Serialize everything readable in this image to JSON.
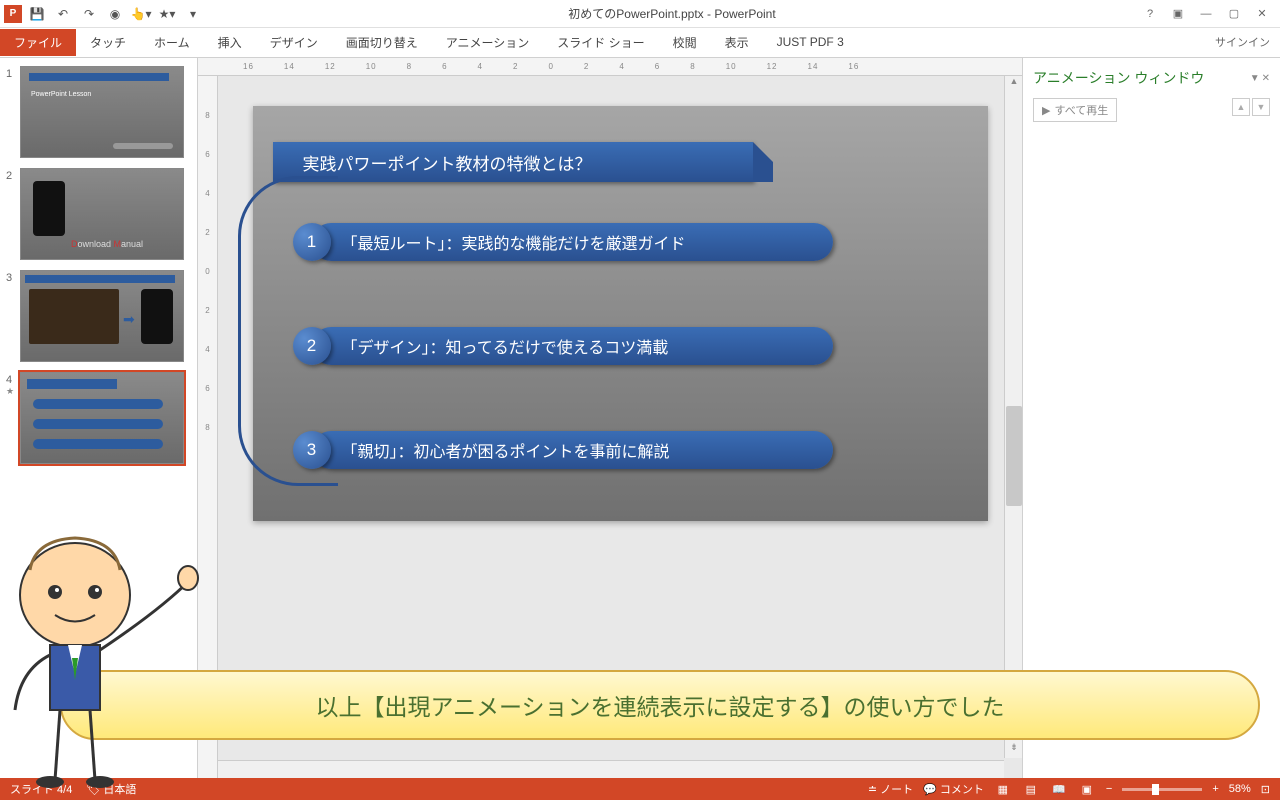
{
  "titlebar": {
    "title": "初めてのPowerPoint.pptx - PowerPoint"
  },
  "tabs": {
    "file": "ファイル",
    "touch": "タッチ",
    "home": "ホーム",
    "insert": "挿入",
    "design": "デザイン",
    "transitions": "画面切り替え",
    "animations": "アニメーション",
    "slideshow": "スライド ショー",
    "review": "校閲",
    "view": "表示",
    "justpdf": "JUST PDF 3",
    "signin": "サインイン"
  },
  "thumbs": {
    "n1": "1",
    "n2": "2",
    "n3": "3",
    "n4": "4",
    "t1": "PowerPoint Lesson",
    "t2a": "D",
    "t2b": "ownload ",
    "t2c": "M",
    "t2d": "anual"
  },
  "slide": {
    "header": "実践パワーポイント教材の特徴とは？",
    "b1n": "1",
    "b1t": "「最短ルート」：実践的な機能だけを厳選ガイド",
    "b2n": "2",
    "b2t": "「デザイン」：知ってるだけで使えるコツ満載",
    "b3n": "3",
    "b3t": "「親切」：初心者が困るポイントを事前に解説"
  },
  "anim": {
    "title": "アニメーション ウィンドウ",
    "playall": "すべて再生"
  },
  "bubble": "以上【出現アニメーションを連続表示に設定する】の使い方でした",
  "status": {
    "slide": "スライド 4/4",
    "lang": "日本語",
    "notes": "ノート",
    "comments": "コメント",
    "zoom": "58%"
  },
  "ruler": {
    "h": [
      "16",
      "14",
      "12",
      "10",
      "8",
      "6",
      "4",
      "2",
      "0",
      "2",
      "4",
      "6",
      "8",
      "10",
      "12",
      "14",
      "16"
    ],
    "v": [
      "8",
      "6",
      "4",
      "2",
      "0",
      "2",
      "4",
      "6",
      "8"
    ]
  }
}
